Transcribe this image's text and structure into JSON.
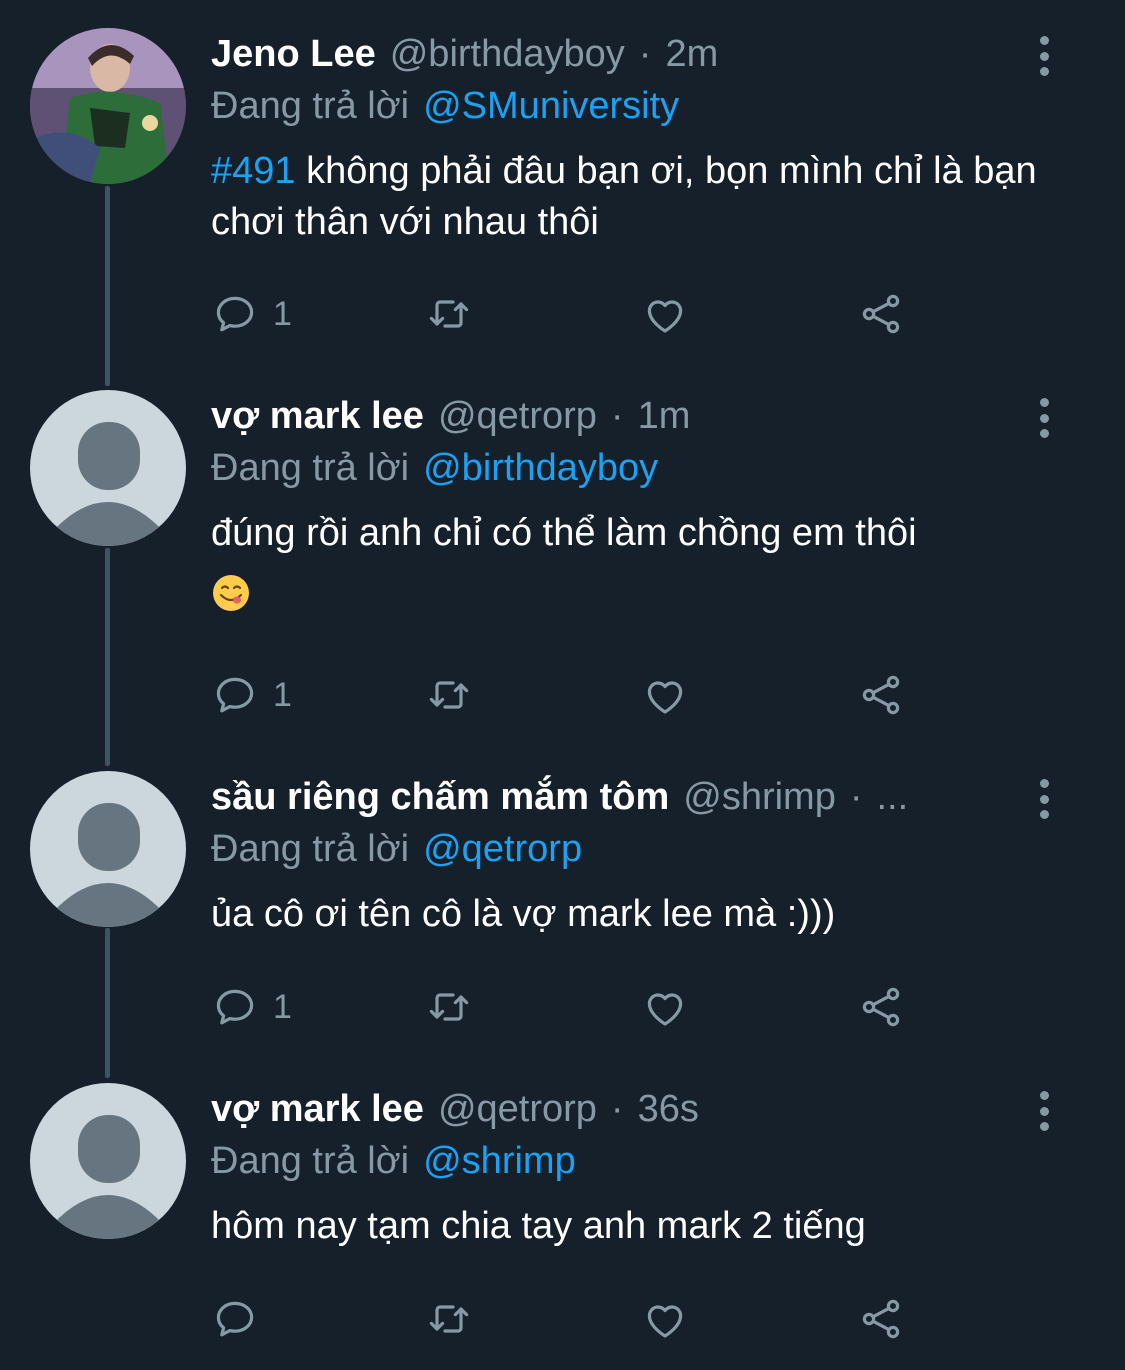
{
  "reply_prefix": "Đang trả lời",
  "tweets": [
    {
      "name": "Jeno Lee",
      "handle": "@birthdayboy",
      "separator": "·",
      "time": "2m",
      "reply_to": "@SMuniversity",
      "hashtag": "#491",
      "text": " không phải đâu bạn ơi, bọn mình chỉ là bạn chơi thân với nhau thôi",
      "reply_count": "1"
    },
    {
      "name": "vợ mark lee",
      "handle": "@qetrorp",
      "separator": "·",
      "time": "1m",
      "reply_to": "@birthdayboy",
      "text": "đúng rồi anh chỉ có thể làm chồng em thôi",
      "emoji": "😋",
      "reply_count": "1"
    },
    {
      "name": "sầu riêng chấm mắm tôm",
      "handle": "@shrimp",
      "separator": "·",
      "time": "...",
      "reply_to": "@qetrorp",
      "text": "ủa cô ơi tên cô là vợ mark lee mà :)))",
      "reply_count": "1"
    },
    {
      "name": "vợ mark lee",
      "handle": "@qetrorp",
      "separator": "·",
      "time": "36s",
      "reply_to": "@shrimp",
      "text": "hôm nay tạm chia tay anh mark 2 tiếng",
      "reply_count": ""
    }
  ],
  "colors": {
    "background": "#15202b",
    "secondary_text": "#8899a6",
    "accent": "#1da1f2",
    "connector": "#3d5466"
  },
  "icons": [
    "reply-icon",
    "retweet-icon",
    "like-icon",
    "share-icon",
    "more-options-icon",
    "default-avatar-icon"
  ]
}
